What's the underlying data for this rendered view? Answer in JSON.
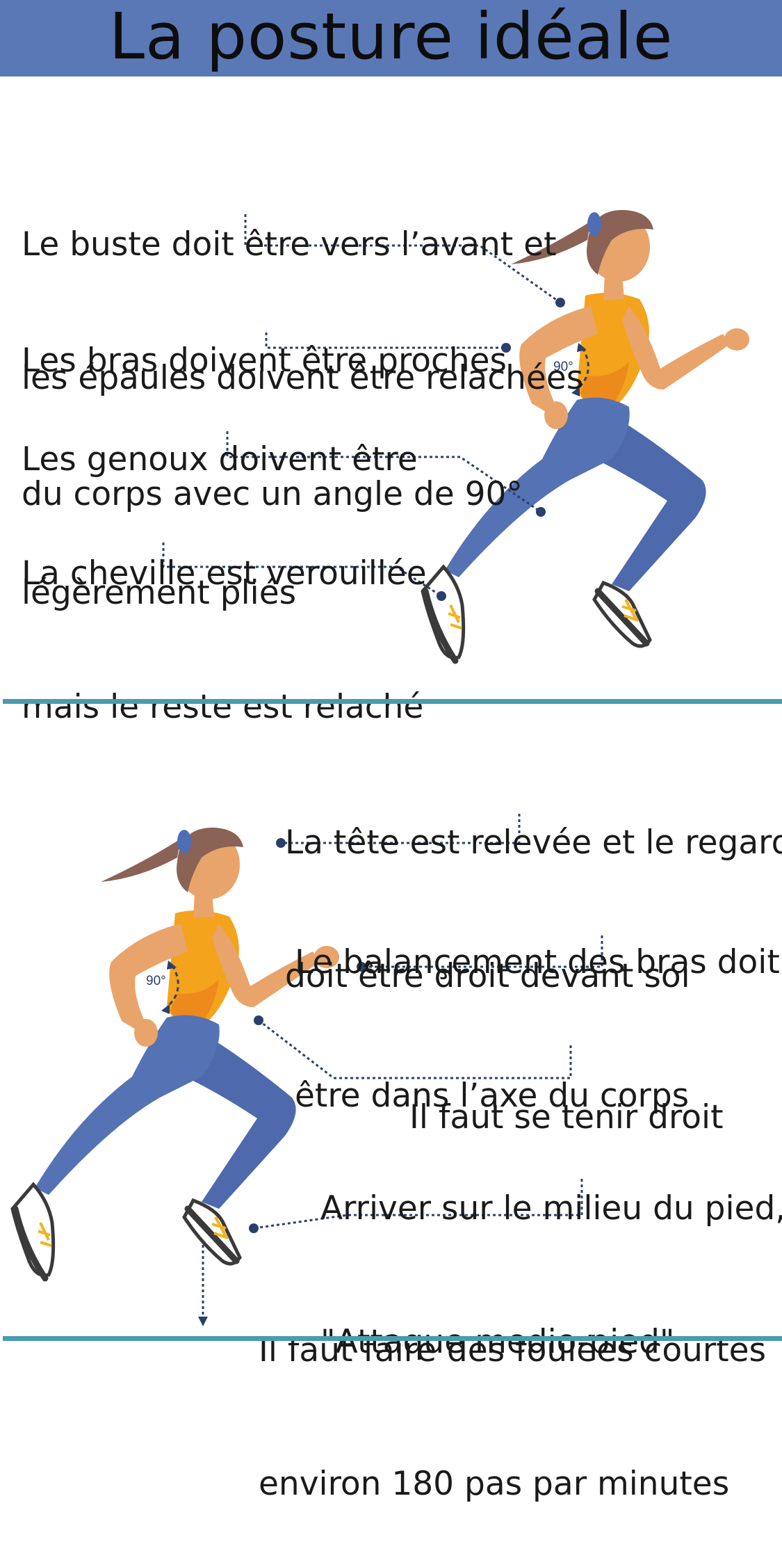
{
  "header": {
    "title": "La posture idéale"
  },
  "colors": {
    "header_bg": "#5b78b6",
    "divider": "#4b9bb0",
    "leader": "#2b3f6b",
    "skin": "#e8a46a",
    "hair": "#8a6256",
    "hair_tie": "#4f6db5",
    "top": "#f4a31c",
    "top_shade": "#ec8a1c",
    "leggings": "#5572b4",
    "shoe": "#3a3a3a",
    "lace": "#f4b21c"
  },
  "section_top": {
    "tips": [
      {
        "lines": [
          "Le buste doit être vers l’avant et",
          "les épaules doivent être relachées"
        ]
      },
      {
        "lines": [
          "Les bras doivent être proches",
          "du corps avec un angle de 90°"
        ]
      },
      {
        "lines": [
          "Les genoux doivent être",
          "légèrement pliés"
        ]
      },
      {
        "lines": [
          "La cheville est verouillée",
          "mais le reste est relaché"
        ]
      }
    ],
    "angle_label": "90°"
  },
  "section_bottom": {
    "tips": [
      {
        "lines": [
          "La tête est relevée et le regard",
          "doit être droit devant soi"
        ]
      },
      {
        "lines": [
          "Le balançement des bras doit",
          "être dans l’axe du corps"
        ]
      },
      {
        "lines": [
          "Il faut se tenir droit"
        ]
      },
      {
        "lines": [
          "Arriver sur le milieu du pied,",
          "\"Attaque medio-pied\""
        ]
      },
      {
        "lines": [
          "Il faut faire des foulées courtes",
          "environ 180 pas par minutes"
        ]
      }
    ],
    "angle_label": "90°"
  }
}
